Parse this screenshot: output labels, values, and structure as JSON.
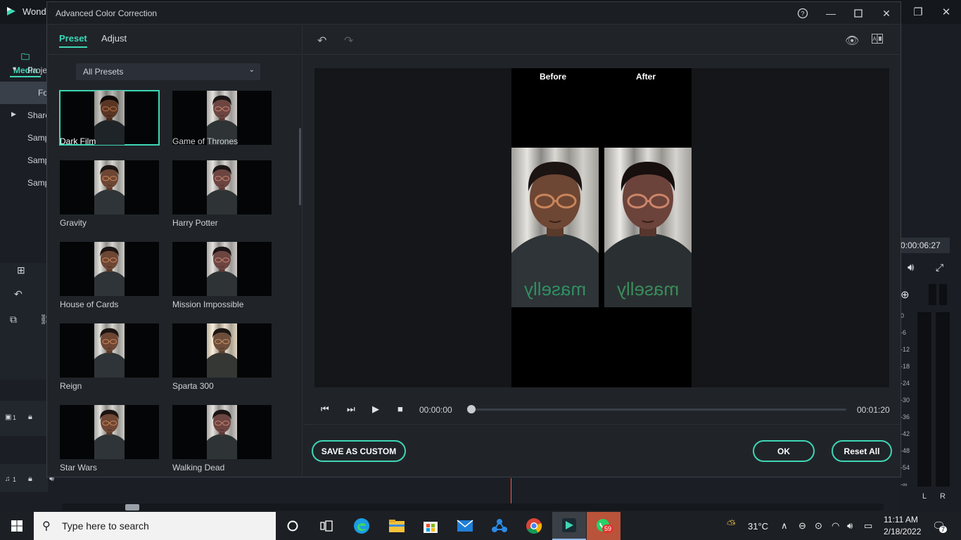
{
  "app": {
    "title": "Wond",
    "media_tab": "Media",
    "tree_items": [
      "Proje",
      "Fo",
      "Share",
      "Samp",
      "Samp",
      "Samp"
    ],
    "timecode": "0:00:06:27",
    "meter_scale": [
      "0",
      "-6",
      "-12",
      "-18",
      "-24",
      "-30",
      "-36",
      "-42",
      "-48",
      "-54",
      "-∞"
    ],
    "meter_l": "L",
    "meter_r": "R",
    "track_video": "1",
    "track_audio": "1"
  },
  "dialog": {
    "title": "Advanced Color Correction",
    "tabs": {
      "preset": "Preset",
      "adjust": "Adjust"
    },
    "preset_filter": "All Presets",
    "presets": [
      {
        "label": "Dark Film",
        "selected": true
      },
      {
        "label": "Game of Thrones",
        "selected": false
      },
      {
        "label": "Gravity",
        "selected": false
      },
      {
        "label": "Harry Potter",
        "selected": false
      },
      {
        "label": "House of Cards",
        "selected": false
      },
      {
        "label": "Mission Impossible",
        "selected": false
      },
      {
        "label": "Reign",
        "selected": false
      },
      {
        "label": "Sparta 300",
        "selected": false
      },
      {
        "label": "Star Wars",
        "selected": false
      },
      {
        "label": "Walking Dead",
        "selected": false
      }
    ],
    "compare": {
      "before": "Before",
      "after": "After"
    },
    "transport": {
      "current": "00:00:00",
      "total": "00:01:20",
      "progress": 0
    },
    "buttons": {
      "save_custom": "SAVE AS CUSTOM",
      "ok": "OK",
      "reset": "Reset All"
    },
    "shirt_text": "maselly"
  },
  "taskbar": {
    "search_placeholder": "Type here to search",
    "weather": "31°C",
    "time": "11:11 AM",
    "date": "2/18/2022",
    "whatsapp_badge": "59",
    "notification_count": "7"
  },
  "colors": {
    "accent": "#3fd6b5",
    "dialog_bg": "#202429",
    "playhead": "#ff5a4a"
  }
}
